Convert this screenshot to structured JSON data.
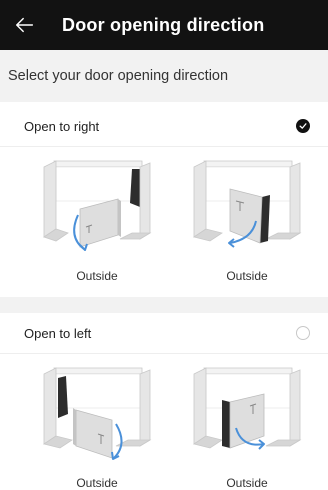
{
  "header": {
    "title": "Door opening direction",
    "back_icon": "arrow-left-icon",
    "background": "#121212"
  },
  "subtitle": "Select your door opening direction",
  "sections": [
    {
      "label": "Open to right",
      "selected": true,
      "options": [
        {
          "label": "Outside"
        },
        {
          "label": "Outside"
        }
      ]
    },
    {
      "label": "Open to left",
      "selected": false,
      "options": [
        {
          "label": "Outside"
        },
        {
          "label": "Outside"
        }
      ]
    }
  ],
  "colors": {
    "arrow": "#4a90d9",
    "wall": "#e3e3e3",
    "checked": "#111111"
  }
}
